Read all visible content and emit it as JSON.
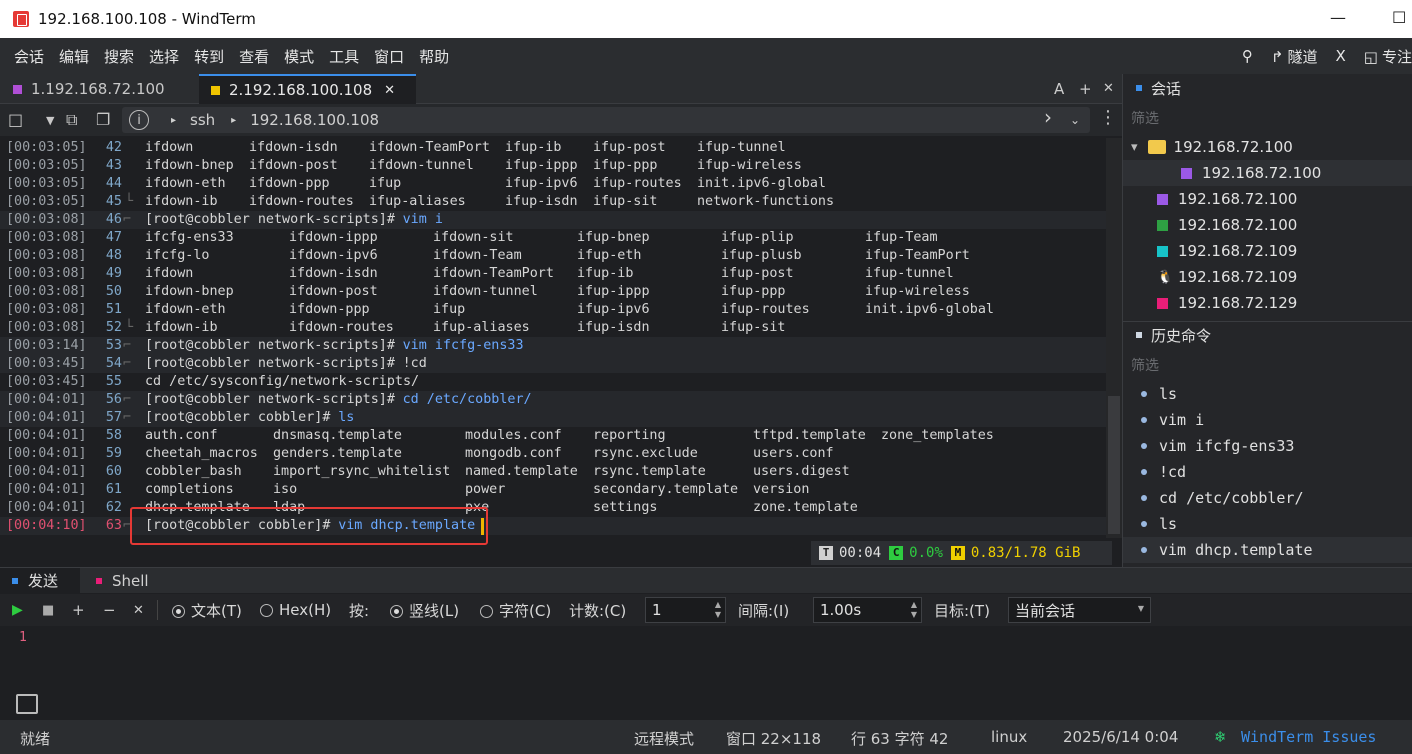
{
  "window": {
    "title": "192.168.100.108 - WindTerm",
    "minimize": "—",
    "maximize": "☐"
  },
  "menu": {
    "items": [
      "会话",
      "编辑",
      "搜索",
      "选择",
      "转到",
      "查看",
      "模式",
      "工具",
      "窗口",
      "帮助"
    ],
    "right": {
      "tunnel": "隧道",
      "x_label": "X",
      "focus": "专注"
    }
  },
  "tabs": [
    {
      "label": "1.192.168.72.100",
      "color": "#b04fd6",
      "active": false
    },
    {
      "label": "2.192.168.100.108",
      "color": "#f0c400",
      "active": true,
      "close": "✕"
    }
  ],
  "tab_tools": {
    "a": "A",
    "plus": "+",
    "close": "✕"
  },
  "toolbar": {
    "protocol": "ssh",
    "host": "192.168.100.108",
    "info": "i"
  },
  "terminal": {
    "lines": [
      {
        "ts": "[00:03:05]",
        "n": "42",
        "cols": [
          [
            "ifdown",
            "cc"
          ],
          [
            "ifdown-isdn",
            "cc"
          ],
          [
            "ifdown-TeamPort",
            "cg"
          ],
          [
            "ifup-ib",
            "cg"
          ],
          [
            "ifup-post",
            "cg"
          ],
          [
            "ifup-tunnel",
            "cg"
          ]
        ]
      },
      {
        "ts": "[00:03:05]",
        "n": "43",
        "cols": [
          [
            "ifdown-bnep",
            "cg"
          ],
          [
            "ifdown-post",
            "cg"
          ],
          [
            "ifdown-tunnel",
            "cg"
          ],
          [
            "ifup-ippp",
            "cg"
          ],
          [
            "ifup-ppp",
            "cg"
          ],
          [
            "ifup-wireless",
            "cg"
          ]
        ]
      },
      {
        "ts": "[00:03:05]",
        "n": "44",
        "cols": [
          [
            "ifdown-eth",
            "cg"
          ],
          [
            "ifdown-ppp",
            "cg"
          ],
          [
            "ifup",
            "cc"
          ],
          [
            "ifup-ipv6",
            "cg"
          ],
          [
            "ifup-routes",
            "cg"
          ],
          [
            "init.ipv6-global",
            "cg"
          ]
        ]
      },
      {
        "ts": "[00:03:05]",
        "n": "45",
        "cols": [
          [
            "ifdown-ib",
            "cg"
          ],
          [
            "ifdown-routes",
            "cg"
          ],
          [
            "ifup-aliases",
            "cg"
          ],
          [
            "ifup-isdn",
            "cc"
          ],
          [
            "ifup-sit",
            "cg"
          ],
          [
            "network-functions",
            "cw"
          ]
        ]
      },
      {
        "ts": "[00:03:08]",
        "n": "46",
        "prompt": true,
        "text": "[root@cobbler network-scripts]# ",
        "cmd": "vim i"
      },
      {
        "ts": "[00:03:08]",
        "n": "47",
        "cols": [
          [
            "ifcfg-ens33",
            "cw"
          ],
          [
            "ifdown-ippp",
            "cw"
          ],
          [
            "ifdown-sit",
            "cw"
          ],
          [
            "ifup-bnep",
            "cw"
          ],
          [
            "ifup-plip",
            "cw"
          ],
          [
            "ifup-Team",
            "cw"
          ]
        ]
      },
      {
        "ts": "[00:03:08]",
        "n": "48",
        "cols": [
          [
            "ifcfg-lo",
            "cw"
          ],
          [
            "ifdown-ipv6",
            "cw"
          ],
          [
            "ifdown-Team",
            "cw"
          ],
          [
            "ifup-eth",
            "cw"
          ],
          [
            "ifup-plusb",
            "cw"
          ],
          [
            "ifup-TeamPort",
            "cw"
          ]
        ]
      },
      {
        "ts": "[00:03:08]",
        "n": "49",
        "cols": [
          [
            "ifdown",
            "cw"
          ],
          [
            "ifdown-isdn",
            "cw"
          ],
          [
            "ifdown-TeamPort",
            "cw"
          ],
          [
            "ifup-ib",
            "cw"
          ],
          [
            "ifup-post",
            "cw"
          ],
          [
            "ifup-tunnel",
            "cw"
          ]
        ]
      },
      {
        "ts": "[00:03:08]",
        "n": "50",
        "cols": [
          [
            "ifdown-bnep",
            "cw"
          ],
          [
            "ifdown-post",
            "cw"
          ],
          [
            "ifdown-tunnel",
            "cw"
          ],
          [
            "ifup-ippp",
            "cw"
          ],
          [
            "ifup-ppp",
            "cw"
          ],
          [
            "ifup-wireless",
            "cw"
          ]
        ]
      },
      {
        "ts": "[00:03:08]",
        "n": "51",
        "cols": [
          [
            "ifdown-eth",
            "cw"
          ],
          [
            "ifdown-ppp",
            "cw"
          ],
          [
            "ifup",
            "cw"
          ],
          [
            "ifup-ipv6",
            "cw"
          ],
          [
            "ifup-routes",
            "cw"
          ],
          [
            "init.ipv6-global",
            "cw"
          ]
        ]
      },
      {
        "ts": "[00:03:08]",
        "n": "52",
        "cols": [
          [
            "ifdown-ib",
            "cw"
          ],
          [
            "ifdown-routes",
            "cw"
          ],
          [
            "ifup-aliases",
            "cw"
          ],
          [
            "ifup-isdn",
            "cw"
          ],
          [
            "ifup-sit",
            "cw"
          ]
        ]
      },
      {
        "ts": "[00:03:14]",
        "n": "53",
        "prompt": true,
        "text": "[root@cobbler network-scripts]# ",
        "cmd": "vim ifcfg-ens33"
      },
      {
        "ts": "[00:03:45]",
        "n": "54",
        "prompt": true,
        "text": "[root@cobbler network-scripts]# ",
        "cmd": "!cd",
        "cmdclass": "cw"
      },
      {
        "ts": "[00:03:45]",
        "n": "55",
        "plain": "cd /etc/sysconfig/network-scripts/"
      },
      {
        "ts": "[00:04:01]",
        "n": "56",
        "prompt": true,
        "text": "[root@cobbler network-scripts]# ",
        "cmd": "cd /etc/cobbler/"
      },
      {
        "ts": "[00:04:01]",
        "n": "57",
        "prompt": true,
        "text": "[root@cobbler cobbler]# ",
        "cmd": "ls"
      },
      {
        "ts": "[00:04:01]",
        "n": "58",
        "wide": true,
        "cols": [
          [
            "auth.conf",
            "cw"
          ],
          [
            "dnsmasq.template",
            "cw"
          ],
          [
            "modules.conf",
            "cw"
          ],
          [
            "reporting",
            "cb"
          ],
          [
            "tftpd.template",
            "cw"
          ],
          [
            "zone_templates",
            "cb"
          ]
        ]
      },
      {
        "ts": "[00:04:01]",
        "n": "59",
        "wide": true,
        "cols": [
          [
            "cheetah_macros",
            "cw"
          ],
          [
            "genders.template",
            "cw"
          ],
          [
            "mongodb.conf",
            "cw"
          ],
          [
            "rsync.exclude",
            "cw"
          ],
          [
            "users.conf",
            "cw"
          ]
        ]
      },
      {
        "ts": "[00:04:01]",
        "n": "60",
        "wide": true,
        "cols": [
          [
            "cobbler_bash",
            "cw"
          ],
          [
            "import_rsync_whitelist",
            "cw"
          ],
          [
            "named.template",
            "cw"
          ],
          [
            "rsync.template",
            "cw"
          ],
          [
            "users.digest",
            "cw"
          ]
        ]
      },
      {
        "ts": "[00:04:01]",
        "n": "61",
        "wide": true,
        "cols": [
          [
            "completions",
            "cw"
          ],
          [
            "iso",
            "cb"
          ],
          [
            "power",
            "cb"
          ],
          [
            "secondary.template",
            "cw"
          ],
          [
            "version",
            "cw"
          ]
        ]
      },
      {
        "ts": "[00:04:01]",
        "n": "62",
        "wide": true,
        "cols": [
          [
            "dhcp.template",
            "cw"
          ],
          [
            "ldap",
            "cb"
          ],
          [
            "pxe",
            "cb"
          ],
          [
            "settings",
            "cw"
          ],
          [
            "zone.template",
            "cw"
          ]
        ]
      },
      {
        "ts": "[00:04:10]",
        "n": "63",
        "prompt": true,
        "current": true,
        "text": "[root@cobbler cobbler]# ",
        "cmd": "vim dhcp.template"
      }
    ]
  },
  "mini_status": {
    "t_badge": "T",
    "time": "00:04",
    "c_badge": "C",
    "cpu": "0.0%",
    "m_badge": "M",
    "mem": "0.83/1.78 GiB"
  },
  "sessions_panel": {
    "title": "会话",
    "filter": "筛选",
    "items": [
      {
        "label": "192.168.72.100",
        "kind": "folder"
      },
      {
        "label": "192.168.72.100",
        "color": "#9b59e6",
        "indent": 2,
        "selected": true
      },
      {
        "label": "192.168.72.100",
        "color": "#9b59e6",
        "indent": 1
      },
      {
        "label": "192.168.72.100",
        "color": "#2ea043",
        "indent": 1
      },
      {
        "label": "192.168.72.109",
        "color": "#17c3c8",
        "indent": 1
      },
      {
        "label": "192.168.72.109",
        "kind": "linux",
        "indent": 1
      },
      {
        "label": "192.168.72.129",
        "color": "#e91e78",
        "indent": 1
      }
    ]
  },
  "history_panel": {
    "title": "历史命令",
    "filter": "筛选",
    "items": [
      "ls",
      "vim i",
      "vim ifcfg-ens33",
      "!cd",
      "cd /etc/cobbler/",
      "ls",
      "vim dhcp.template"
    ]
  },
  "bottom_tabs": [
    {
      "label": "发送",
      "color": "#3b8eea"
    },
    {
      "label": "Shell",
      "color": "#e91e78"
    }
  ],
  "send_bar": {
    "text_mode": "文本(T)",
    "hex_mode": "Hex(H)",
    "by_label": "按:",
    "vertical": "竖线(L)",
    "char": "字符(C)",
    "count_label": "计数:(C)",
    "count_value": "1",
    "interval_label": "间隔:(I)",
    "interval_value": "1.00s",
    "target_label": "目标:(T)",
    "target_value": "当前会话"
  },
  "editor": {
    "line_number": "1"
  },
  "statusbar": {
    "ready": "就绪",
    "mode": "远程模式",
    "window": "窗口 22×118",
    "position": "行 63 字符 42",
    "os": "linux",
    "datetime": "2025/6/14 0:04",
    "issues": "WindTerm Issues"
  }
}
